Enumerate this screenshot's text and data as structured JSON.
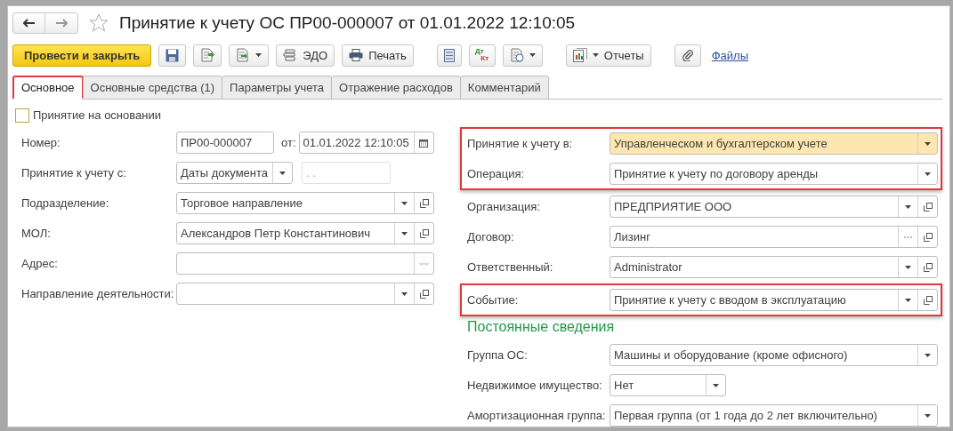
{
  "window": {
    "title": "Принятие к учету ОС ПР00-000007 от 01.01.2022 12:10:05",
    "favorite": false
  },
  "toolbar": {
    "primary": "Провести и закрыть",
    "edo": "ЭДО",
    "print": "Печать",
    "dt": "Дт",
    "kt": "Кт",
    "reports": "Отчеты",
    "files_link": "Файлы"
  },
  "tabs": [
    {
      "label": "Основное",
      "selected": true,
      "highlighted": true
    },
    {
      "label": "Основные средства (1)",
      "selected": false,
      "highlighted": false
    },
    {
      "label": "Параметры учета",
      "selected": false,
      "highlighted": false
    },
    {
      "label": "Отражение расходов",
      "selected": false,
      "highlighted": false
    },
    {
      "label": "Комментарий",
      "selected": false,
      "highlighted": false
    }
  ],
  "basis_checkbox": {
    "label": "Принятие на основании",
    "checked": false
  },
  "left_rows": [
    {
      "kind": "number_date",
      "label": "Номер:",
      "value": "ПР00-000007",
      "date_label": "от:",
      "date": "01.01.2022 12:10:05"
    },
    {
      "kind": "period",
      "label": "Принятие к учету с:",
      "value": "Даты документа",
      "date": ". .",
      "date_disabled": true
    },
    {
      "kind": "field",
      "label": "Подразделение:",
      "value": "Торговое направление",
      "buttons": [
        {
          "kind": "dropdown"
        },
        {
          "kind": "open"
        }
      ]
    },
    {
      "kind": "field",
      "label": "МОЛ:",
      "value": "Александров Петр Константинович",
      "buttons": [
        {
          "kind": "dropdown"
        },
        {
          "kind": "open"
        }
      ]
    },
    {
      "kind": "field",
      "label": "Адрес:",
      "buttons": [
        {
          "kind": "choose"
        }
      ]
    },
    {
      "kind": "field",
      "label": "Направление деятельности:",
      "buttons": [
        {
          "kind": "dropdown"
        },
        {
          "kind": "open"
        }
      ]
    }
  ],
  "right_groups": [
    {
      "highlighted": true,
      "fields": [
        {
          "label": "Принятие к учету в:",
          "value": "Управленческом и бухгалтерском учете",
          "marked": true,
          "buttons": [
            {
              "kind": "dropdown"
            }
          ]
        },
        {
          "label": "Операция:",
          "value": "Принятие к учету по договору аренды",
          "marked": false,
          "buttons": [
            {
              "kind": "dropdown"
            }
          ]
        }
      ]
    },
    {
      "highlighted": false,
      "fields": [
        {
          "label": "Организация:",
          "value": "ПРЕДПРИЯТИЕ ООО",
          "marked": false,
          "buttons": [
            {
              "kind": "dropdown"
            },
            {
              "kind": "open"
            }
          ]
        },
        {
          "label": "Договор:",
          "value": "Лизинг",
          "marked": false,
          "buttons": [
            {
              "kind": "choose"
            },
            {
              "kind": "open"
            }
          ]
        },
        {
          "label": "Ответственный:",
          "value": "Administrator",
          "marked": false,
          "buttons": [
            {
              "kind": "dropdown"
            },
            {
              "kind": "open"
            }
          ]
        }
      ]
    },
    {
      "highlighted": true,
      "fields": [
        {
          "label": "Событие:",
          "value": "Принятие к учету с вводом в эксплуатацию",
          "marked": false,
          "buttons": [
            {
              "kind": "dropdown"
            },
            {
              "kind": "open"
            }
          ]
        }
      ]
    }
  ],
  "permanent": {
    "heading": "Постоянные сведения",
    "fields": [
      {
        "label": "Группа ОС:",
        "value": "Машины и оборудование (кроме офисного)",
        "short": false,
        "buttons": [
          {
            "kind": "dropdown"
          }
        ]
      },
      {
        "label": "Недвижимое имущество:",
        "value": "Нет",
        "short": true,
        "buttons": [
          {
            "kind": "dropdown"
          }
        ]
      },
      {
        "label": "Амортизационная группа:",
        "value": "Первая группа (от 1 года до 2 лет включительно)",
        "short": false,
        "buttons": [
          {
            "kind": "dropdown"
          }
        ]
      }
    ]
  }
}
